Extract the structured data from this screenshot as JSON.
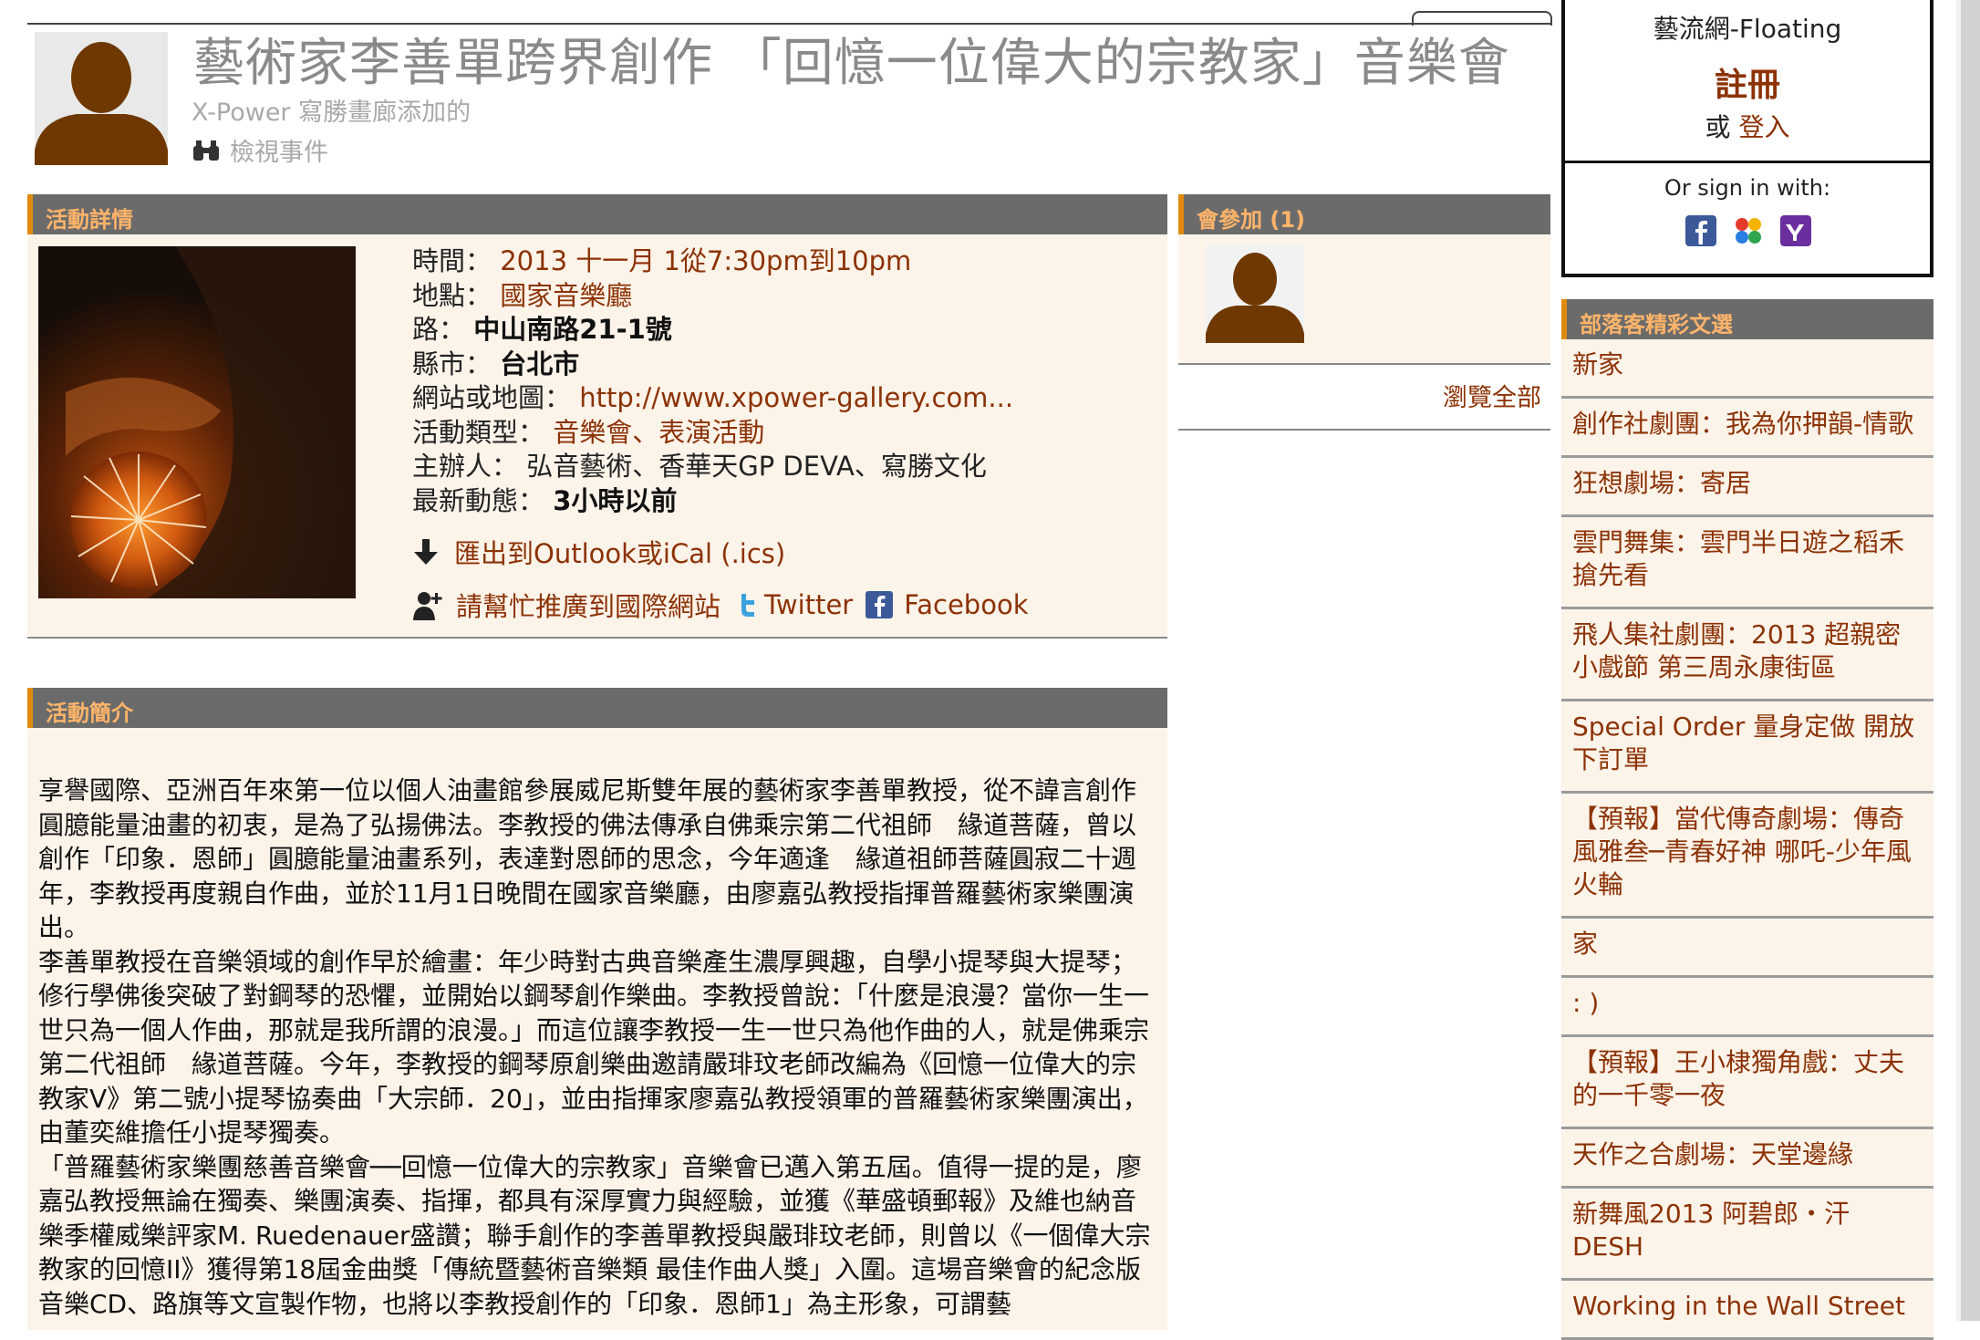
{
  "event": {
    "title": "藝術家李善單跨界創作 「回憶一位偉大的宗教家」音樂會",
    "added_by": "X-Power 寫勝畫廊添加的",
    "view_event": "檢視事件"
  },
  "details_panel": {
    "header": "活動詳情",
    "rows": [
      {
        "label": "時間：",
        "value": "2013 十一月 1從7:30pm到10pm"
      },
      {
        "label": "地點：",
        "value": "國家音樂廳"
      },
      {
        "label": "路：",
        "value": "中山南路21-1號"
      },
      {
        "label": "縣市：",
        "value": "台北市"
      },
      {
        "label": "網站或地圖：",
        "value": "http://www.xpower-gallery.com..."
      },
      {
        "label": "活動類型：",
        "value": "音樂會、表演活動"
      },
      {
        "label": "主辦人：",
        "value": "弘音藝術、香華天GP DEVA、寫勝文化"
      },
      {
        "label": "最新動態：",
        "value": "3小時以前"
      }
    ],
    "export": "匯出到Outlook或iCal (.ics)",
    "promote": "請幫忙推廣到國際網站",
    "twitter": "Twitter",
    "facebook": "Facebook"
  },
  "intro_panel": {
    "header": "活動簡介",
    "paragraphs": [
      "享譽國際、亞洲百年來第一位以個人油畫館參展威尼斯雙年展的藝術家李善單教授，從不諱言創作圓臆能量油畫的初衷，是為了弘揚佛法。李教授的佛法傳承自佛乘宗第二代祖師　緣道菩薩，曾以創作「印象．恩師」圓臆能量油畫系列，表達對恩師的思念，今年適逢　緣道祖師菩薩圓寂二十週年，李教授再度親自作曲，並於11月1日晚間在國家音樂廳，由廖嘉弘教授指揮普羅藝術家樂團演出。",
      "李善單教授在音樂領域的創作早於繪畫：年少時對古典音樂產生濃厚興趣，自學小提琴與大提琴；修行學佛後突破了對鋼琴的恐懼，並開始以鋼琴創作樂曲。李教授曾說：「什麼是浪漫？當你一生一世只為一個人作曲，那就是我所謂的浪漫。」而這位讓李教授一生一世只為他作曲的人，就是佛乘宗第二代祖師　緣道菩薩。今年，李教授的鋼琴原創樂曲邀請嚴琲玟老師改編為《回憶一位偉大的宗教家V》第二號小提琴協奏曲「大宗師．20」，並由指揮家廖嘉弘教授領軍的普羅藝術家樂團演出，由董奕維擔任小提琴獨奏。",
      "「普羅藝術家樂團慈善音樂會──回憶一位偉大的宗教家」音樂會已邁入第五屆。值得一提的是，廖嘉弘教授無論在獨奏、樂團演奏、指揮，都具有深厚實力與經驗，並獲《華盛頓郵報》及維也納音樂季權威樂評家M. Ruedenauer盛讚；聯手創作的李善單教授與嚴琲玟老師，則曾以《一個偉大宗教家的回憶II》獲得第18屆金曲獎「傳統暨藝術音樂類 最佳作曲人獎」入圍。這場音樂會的紀念版音樂CD、路旗等文宣製作物，也將以李教授創作的「印象．恩師1」為主形象，可謂藝"
    ]
  },
  "attendees_panel": {
    "header": "會參加 (1)",
    "view_all": "瀏覽全部"
  },
  "login": {
    "site_name": "藝流網-Floating",
    "register": "註冊",
    "or": "或",
    "login_link": "登入",
    "sign_in_with": "Or sign in with:"
  },
  "blog_panel": {
    "header": "部落客精彩文選",
    "items": [
      "新家",
      "創作社劇團：我為你押韻-情歌",
      "狂想劇場：寄居",
      "雲門舞集：雲門半日遊之稻禾搶先看",
      "飛人集社劇團：2013 超親密小戲節 第三周永康街區",
      "Special Order 量身定做 開放下訂單",
      "【預報】當代傳奇劇場：傳奇風雅叁─青春好神 哪吒-少年風火輪",
      "家",
      ": )",
      "【預報】王小棣獨角戲：丈夫的一千零一夜",
      "天作之合劇場：天堂邊緣",
      "新舞風2013 阿碧郎・汗 DESH",
      "Working in the Wall Street"
    ]
  },
  "colors": {
    "accent_orange": "#e08a10",
    "header_label": "#ffb46a",
    "panel_bg": "#fcf3e9",
    "link_brown": "#8c3205",
    "bar_grey": "#6b6b6b"
  }
}
